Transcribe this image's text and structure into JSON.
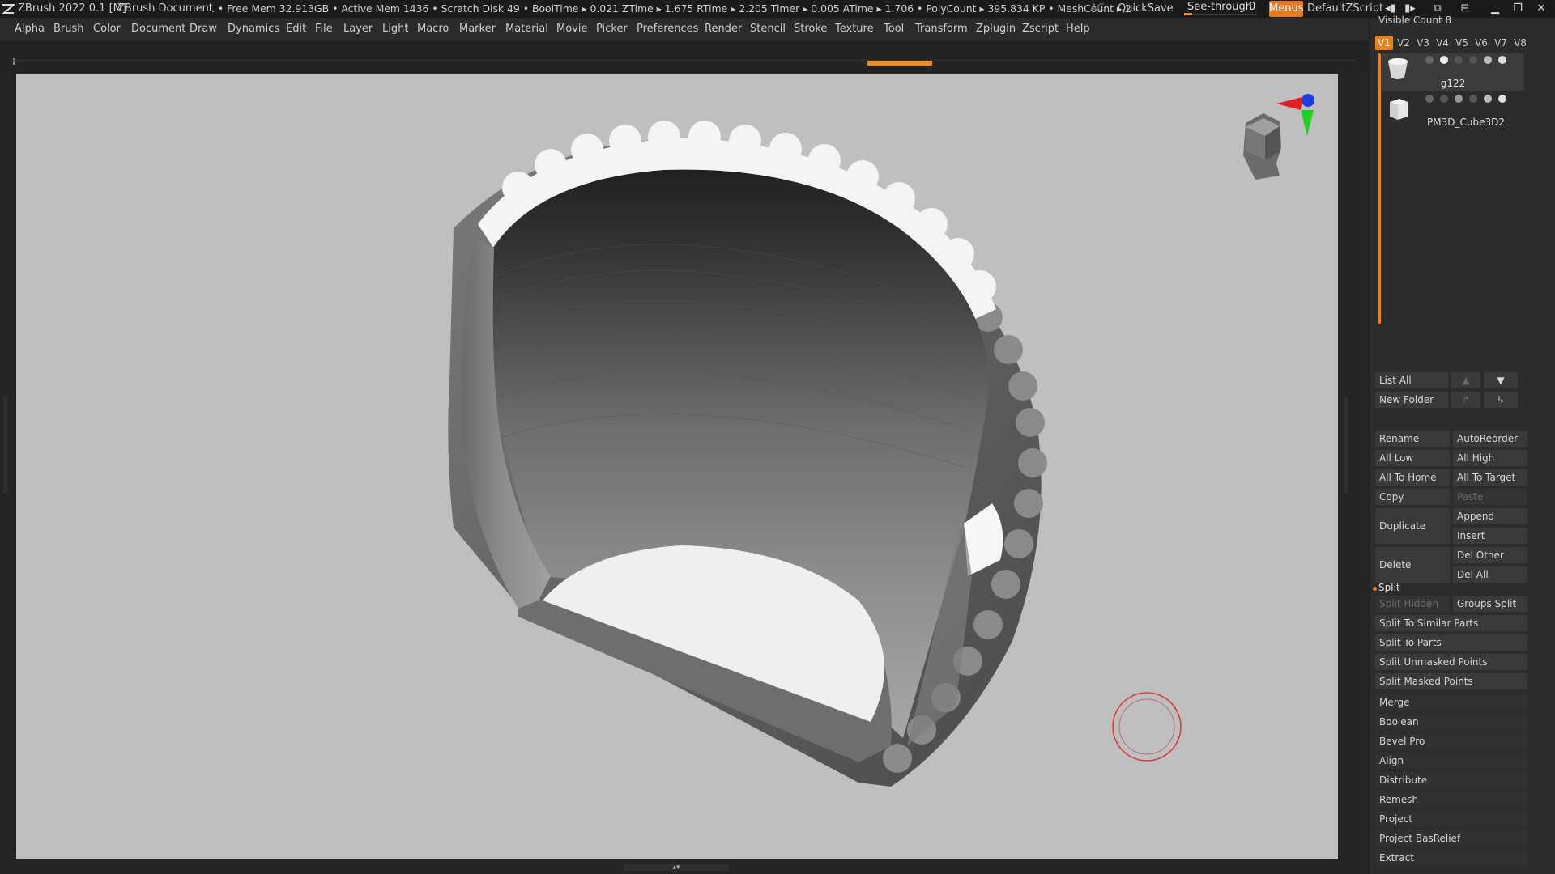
{
  "titlebar": {
    "app": "ZBrush 2022.0.1 [M]",
    "document": "ZBrush Document",
    "stats": ". • Free Mem 32.913GB • Active Mem 1436 • Scratch Disk 49 •  BoolTime ▸ 0.021 ZTime ▸ 1.675 RTime ▸ 2.205 Timer ▸ 0.005 ATime ▸ 1.706 • PolyCount ▸ 395.834 KP  • MeshCount ▸ 2",
    "ac": "AC",
    "quicksave": "QuickSave",
    "see_through_label": "See-through",
    "see_through_value": "0",
    "see_through_fraction": 0.0,
    "menus": "Menus",
    "script": "DefaultZScript"
  },
  "menubar": [
    "Alpha",
    "Brush",
    "Color",
    "Document",
    "Draw",
    "Dynamics",
    "Edit",
    "File",
    "Layer",
    "Light",
    "Macro",
    "Marker",
    "Material",
    "Movie",
    "Picker",
    "Preferences",
    "Render",
    "Stencil",
    "Stroke",
    "Texture",
    "Tool",
    "Transform",
    "Zplugin",
    "Zscript",
    "Help"
  ],
  "subtool": {
    "visible_count": "Visible Count 8",
    "tabs": [
      "V1",
      "V2",
      "V3",
      "V4",
      "V5",
      "V6",
      "V7",
      "V8"
    ],
    "active_tab": "V1",
    "items": [
      {
        "name": "g122"
      },
      {
        "name": "PM3D_Cube3D2"
      }
    ]
  },
  "panel": {
    "list_all": "List All",
    "new_folder": "New Folder",
    "rename": "Rename",
    "autoreorder": "AutoReorder",
    "all_low": "All Low",
    "all_high": "All High",
    "all_to_home": "All To Home",
    "all_to_target": "All To Target",
    "copy": "Copy",
    "paste": "Paste",
    "duplicate": "Duplicate",
    "append": "Append",
    "insert": "Insert",
    "delete": "Delete",
    "del_other": "Del Other",
    "del_all": "Del All",
    "split": "Split",
    "split_hidden": "Split Hidden",
    "groups_split": "Groups Split",
    "split_similar": "Split To Similar Parts",
    "split_parts": "Split To Parts",
    "split_unmasked": "Split Unmasked Points",
    "split_masked": "Split Masked Points",
    "sections": [
      "Merge",
      "Boolean",
      "Bevel Pro",
      "Align",
      "Distribute",
      "Remesh",
      "Project",
      "Project BasRelief",
      "Extract"
    ]
  },
  "colors": {
    "accent": "#e8821f",
    "background": "#242424",
    "viewport": "#bfbfbf"
  }
}
